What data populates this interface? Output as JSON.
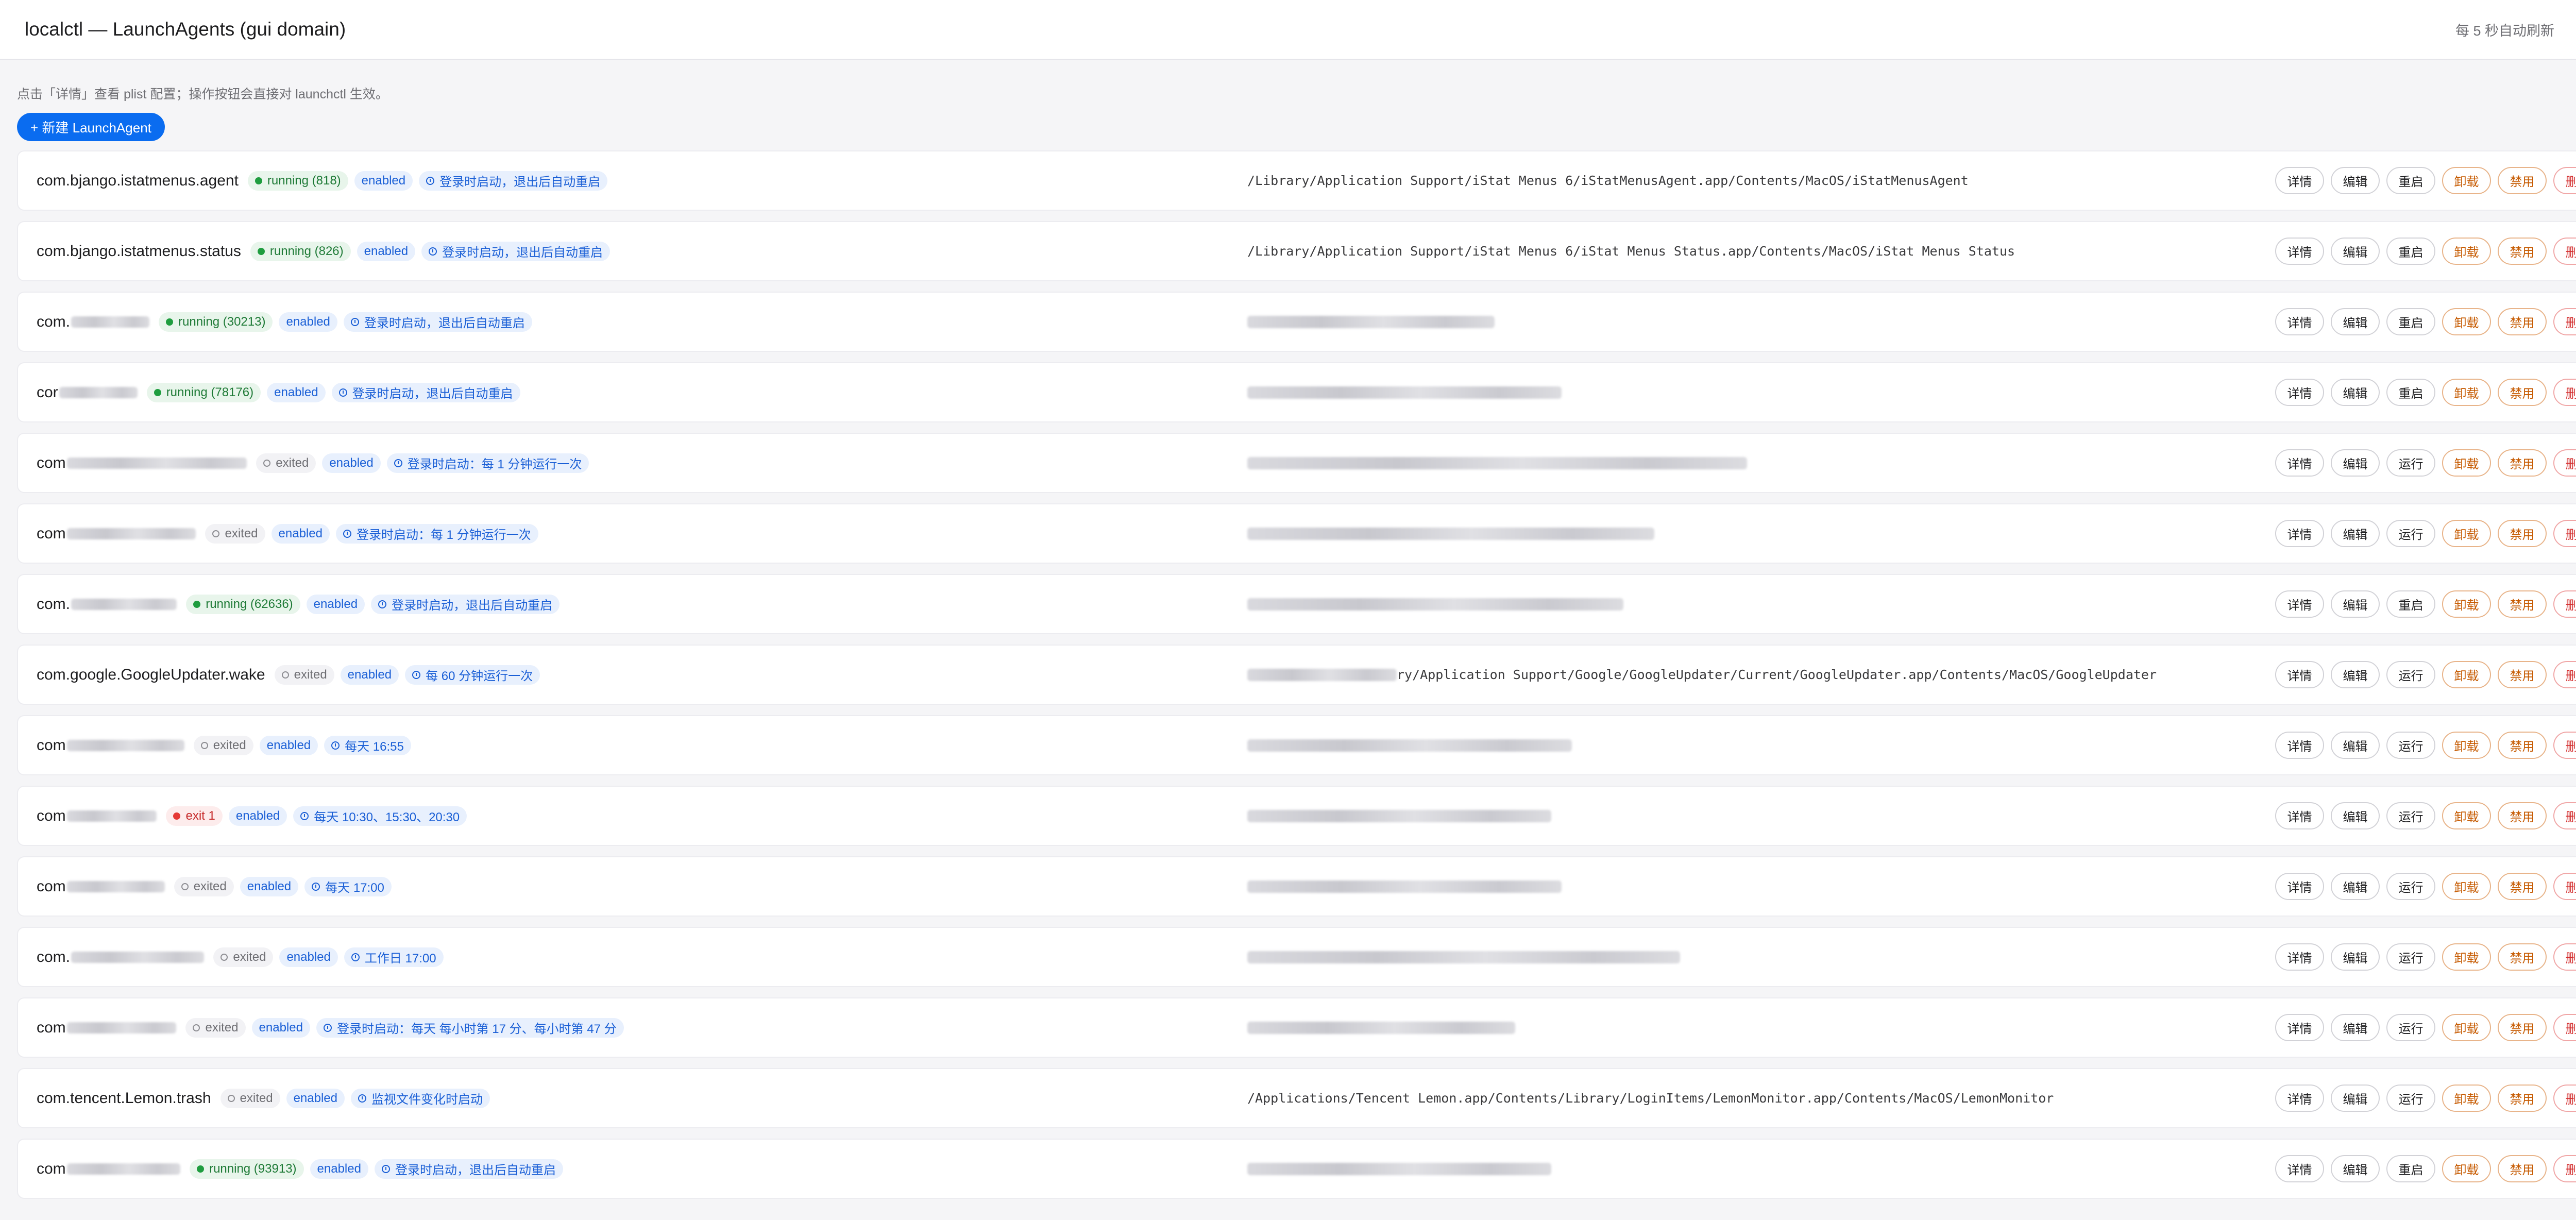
{
  "header": {
    "title": "localctl — LaunchAgents (gui domain)",
    "refresh_text": "每 5 秒自动刷新",
    "screen_icon": "monitor-icon"
  },
  "hint": "点击「详情」查看 plist 配置；操作按钮会直接对 launchctl 生效。",
  "new_button": "+ 新建 LaunchAgent",
  "labels": {
    "details": "详情",
    "edit": "编辑",
    "restart": "重启",
    "run": "运行",
    "unload": "卸载",
    "disable": "禁用",
    "delete": "删除"
  },
  "agents": [
    {
      "label": "com.bjango.istatmenus.agent",
      "blur": 0,
      "status": "running (818)",
      "state": "running",
      "enabled": "enabled",
      "schedule": "登录时启动，退出后自动重启",
      "path": "/Library/Application Support/iStat Menus 6/iStatMenusAgent.app/Contents/MacOS/iStatMenusAgent",
      "path_blur": 0,
      "primary_action": "restart"
    },
    {
      "label": "com.bjango.istatmenus.status",
      "blur": 0,
      "status": "running (826)",
      "state": "running",
      "enabled": "enabled",
      "schedule": "登录时启动，退出后自动重启",
      "path": "/Library/Application Support/iStat Menus 6/iStat Menus Status.app/Contents/MacOS/iStat Menus Status",
      "path_blur": 0,
      "primary_action": "restart"
    },
    {
      "label": "com.",
      "blur": 200,
      "status": "running (30213)",
      "state": "running",
      "enabled": "enabled",
      "schedule": "登录时启动，退出后自动重启",
      "path": "",
      "path_blur": 480,
      "primary_action": "restart"
    },
    {
      "label": "cor",
      "blur": 200,
      "status": "running (78176)",
      "state": "running",
      "enabled": "enabled",
      "schedule": "登录时启动，退出后自动重启",
      "path": "",
      "path_blur": 610,
      "primary_action": "restart"
    },
    {
      "label": "com",
      "blur": 460,
      "status": "exited",
      "state": "exited",
      "enabled": "enabled",
      "schedule": "登录时启动：每 1 分钟运行一次",
      "path": "",
      "path_blur": 970,
      "primary_action": "run"
    },
    {
      "label": "com",
      "blur": 330,
      "status": "exited",
      "state": "exited",
      "enabled": "enabled",
      "schedule": "登录时启动：每 1 分钟运行一次",
      "path": "",
      "path_blur": 790,
      "primary_action": "run"
    },
    {
      "label": "com.",
      "blur": 270,
      "status": "running (62636)",
      "state": "running",
      "enabled": "enabled",
      "schedule": "登录时启动，退出后自动重启",
      "path": "",
      "path_blur": 730,
      "primary_action": "restart"
    },
    {
      "label": "com.google.GoogleUpdater.wake",
      "blur": 0,
      "status": "exited",
      "state": "exited",
      "enabled": "enabled",
      "schedule": "每 60 分钟运行一次",
      "path": "ry/Application Support/Google/GoogleUpdater/Current/GoogleUpdater.app/Contents/MacOS/GoogleUpdater",
      "path_blur": 290,
      "primary_action": "run"
    },
    {
      "label": "com",
      "blur": 300,
      "status": "exited",
      "state": "exited",
      "enabled": "enabled",
      "schedule": "每天 16:55",
      "path": "",
      "path_blur": 630,
      "primary_action": "run"
    },
    {
      "label": "com",
      "blur": 230,
      "status": "exit 1",
      "state": "error",
      "enabled": "enabled",
      "schedule": "每天 10:30、15:30、20:30",
      "path": "",
      "path_blur": 590,
      "primary_action": "run"
    },
    {
      "label": "com",
      "blur": 250,
      "status": "exited",
      "state": "exited",
      "enabled": "enabled",
      "schedule": "每天 17:00",
      "path": "",
      "path_blur": 610,
      "primary_action": "run"
    },
    {
      "label": "com.",
      "blur": 340,
      "status": "exited",
      "state": "exited",
      "enabled": "enabled",
      "schedule": "工作日 17:00",
      "path": "",
      "path_blur": 840,
      "primary_action": "run"
    },
    {
      "label": "com",
      "blur": 280,
      "status": "exited",
      "state": "exited",
      "enabled": "enabled",
      "schedule": "登录时启动：每天 每小时第 17 分、每小时第 47 分",
      "path": "",
      "path_blur": 520,
      "primary_action": "run"
    },
    {
      "label": "com.tencent.Lemon.trash",
      "blur": 0,
      "status": "exited",
      "state": "exited",
      "enabled": "enabled",
      "schedule": "监视文件变化时启动",
      "path": "/Applications/Tencent Lemon.app/Contents/Library/LoginItems/LemonMonitor.app/Contents/MacOS/LemonMonitor",
      "path_blur": 0,
      "primary_action": "run"
    },
    {
      "label": "com",
      "blur": 290,
      "status": "running (93913)",
      "state": "running",
      "enabled": "enabled",
      "schedule": "登录时启动，退出后自动重启",
      "path": "",
      "path_blur": 590,
      "primary_action": "restart"
    }
  ]
}
